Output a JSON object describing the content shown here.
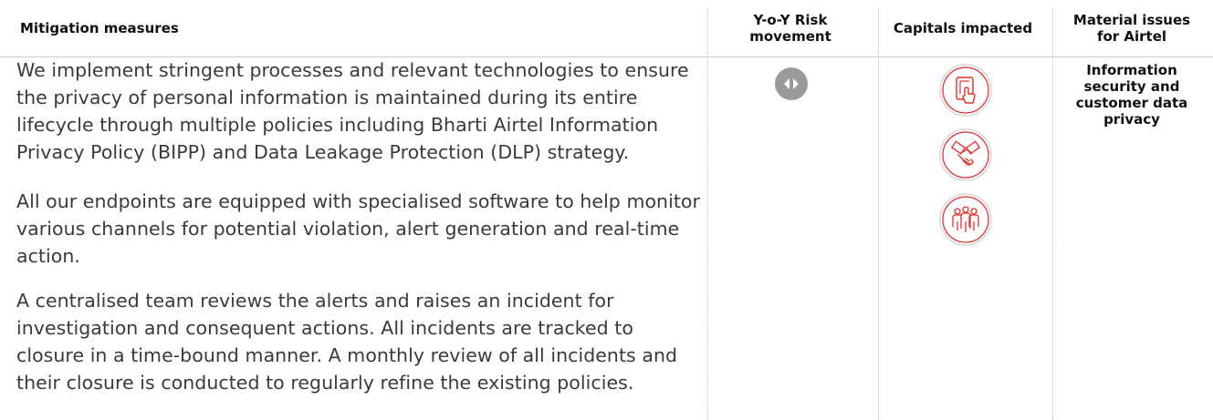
{
  "header": {
    "mitigation": "Mitigation measures",
    "risk_line1": "Y-o-Y Risk",
    "risk_line2": "movement",
    "capitals": "Capitals impacted",
    "material_line1": "Material issues",
    "material_line2": "for Airtel"
  },
  "paragraphs": [
    "We implement stringent processes and relevant technologies to ensure the privacy of personal information is maintained during its entire lifecycle through multiple policies including Bharti Airtel Information Privacy Policy (BIPP) and Data Leakage Protection (DLP) strategy.",
    "All our endpoints are equipped with specialised software to help monitor various channels for potential violation, alert generation and real-time action.",
    "A centralised team reviews the alerts and raises an incident for investigation and consequent actions. All incidents are tracked to closure in a time-bound manner. A monthly review of all incidents and their closure is conducted to regularly refine the existing policies."
  ],
  "risk_movement": {
    "icon": "risk-unchanged-icon",
    "color": "#9a9a9a"
  },
  "capitals_icons": [
    {
      "icon": "digital-touch-icon",
      "color": "#e4302b"
    },
    {
      "icon": "handshake-icon",
      "color": "#e4302b"
    },
    {
      "icon": "people-group-icon",
      "color": "#e4302b"
    }
  ],
  "material_issue": {
    "line1": "Information",
    "line2": "security and",
    "line3": "customer data",
    "line4": "privacy"
  }
}
